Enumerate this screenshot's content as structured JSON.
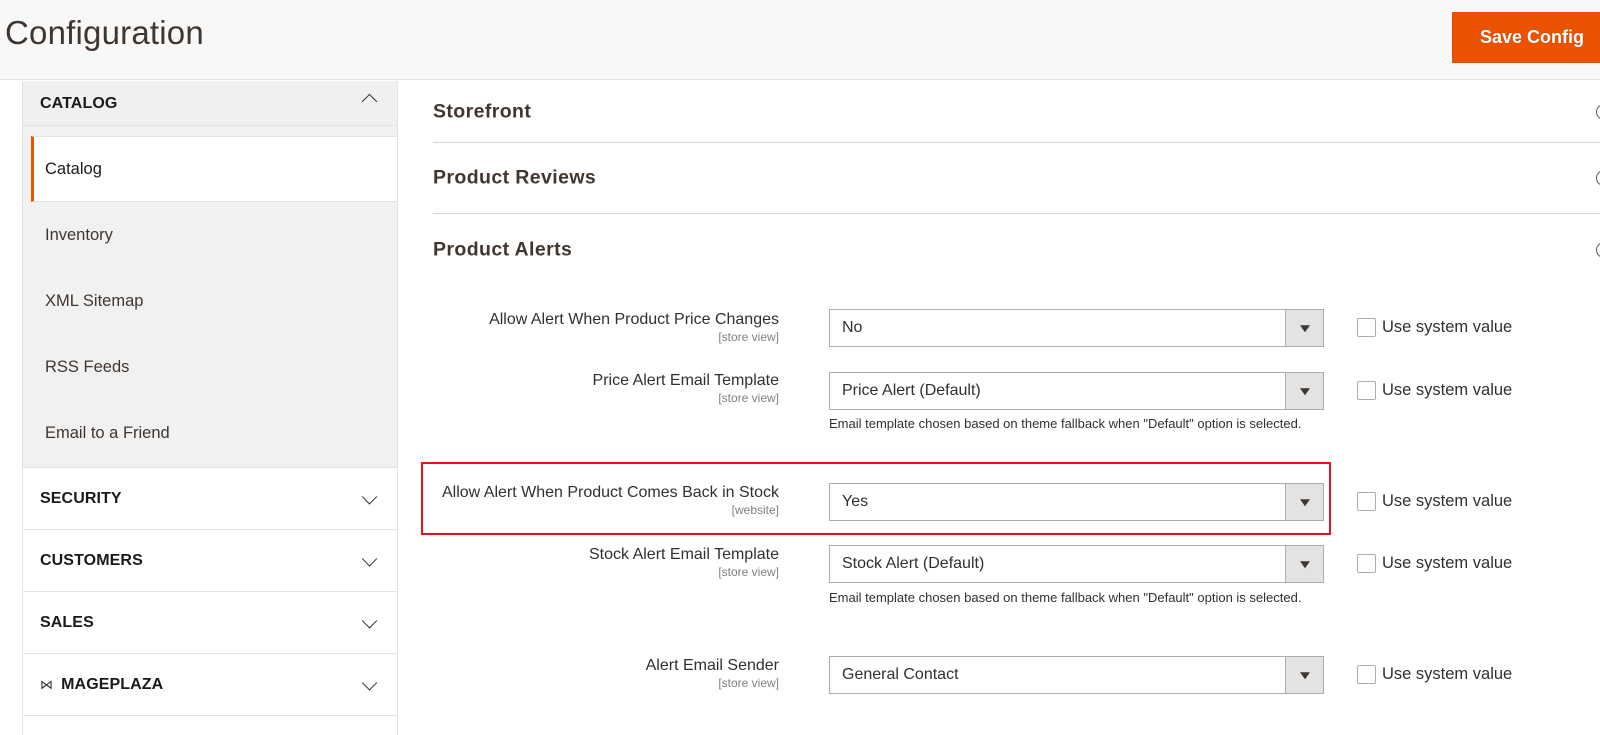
{
  "header": {
    "title": "Configuration",
    "save_label": "Save Config",
    "accent_color": "#eb5202"
  },
  "sidebar": {
    "catalog_section": {
      "label": "CATALOG",
      "expanded": true,
      "items": [
        {
          "label": "Catalog",
          "active": true
        },
        {
          "label": "Inventory",
          "active": false
        },
        {
          "label": "XML Sitemap",
          "active": false
        },
        {
          "label": "RSS Feeds",
          "active": false
        },
        {
          "label": "Email to a Friend",
          "active": false
        }
      ]
    },
    "sections": [
      {
        "label": "SECURITY",
        "icon": null
      },
      {
        "label": "CUSTOMERS",
        "icon": null
      },
      {
        "label": "SALES",
        "icon": null
      },
      {
        "label": "MAGEPLAZA",
        "icon": "mageplaza-logo-icon"
      }
    ]
  },
  "main": {
    "groups": [
      {
        "title": "Storefront",
        "expanded": false
      },
      {
        "title": "Product Reviews",
        "expanded": false
      },
      {
        "title": "Product Alerts",
        "expanded": true
      }
    ],
    "fields": [
      {
        "label": "Allow Alert When Product Price Changes",
        "scope": "[store view]",
        "value": "No",
        "note": null,
        "use_system_value": false,
        "use_system_label": "Use system value"
      },
      {
        "label": "Price Alert Email Template",
        "scope": "[store view]",
        "value": "Price Alert (Default)",
        "note": "Email template chosen based on theme fallback when \"Default\" option is selected.",
        "use_system_value": false,
        "use_system_label": "Use system value"
      },
      {
        "label": "Allow Alert When Product Comes Back in Stock",
        "scope": "[website]",
        "value": "Yes",
        "note": null,
        "use_system_value": false,
        "use_system_label": "Use system value",
        "highlighted": true
      },
      {
        "label": "Stock Alert Email Template",
        "scope": "[store view]",
        "value": "Stock Alert (Default)",
        "note": "Email template chosen based on theme fallback when \"Default\" option is selected.",
        "use_system_value": false,
        "use_system_label": "Use system value"
      },
      {
        "label": "Alert Email Sender",
        "scope": "[store view]",
        "value": "General Contact",
        "note": null,
        "use_system_value": false,
        "use_system_label": "Use system value"
      }
    ],
    "highlight_color": "#e8101a"
  }
}
